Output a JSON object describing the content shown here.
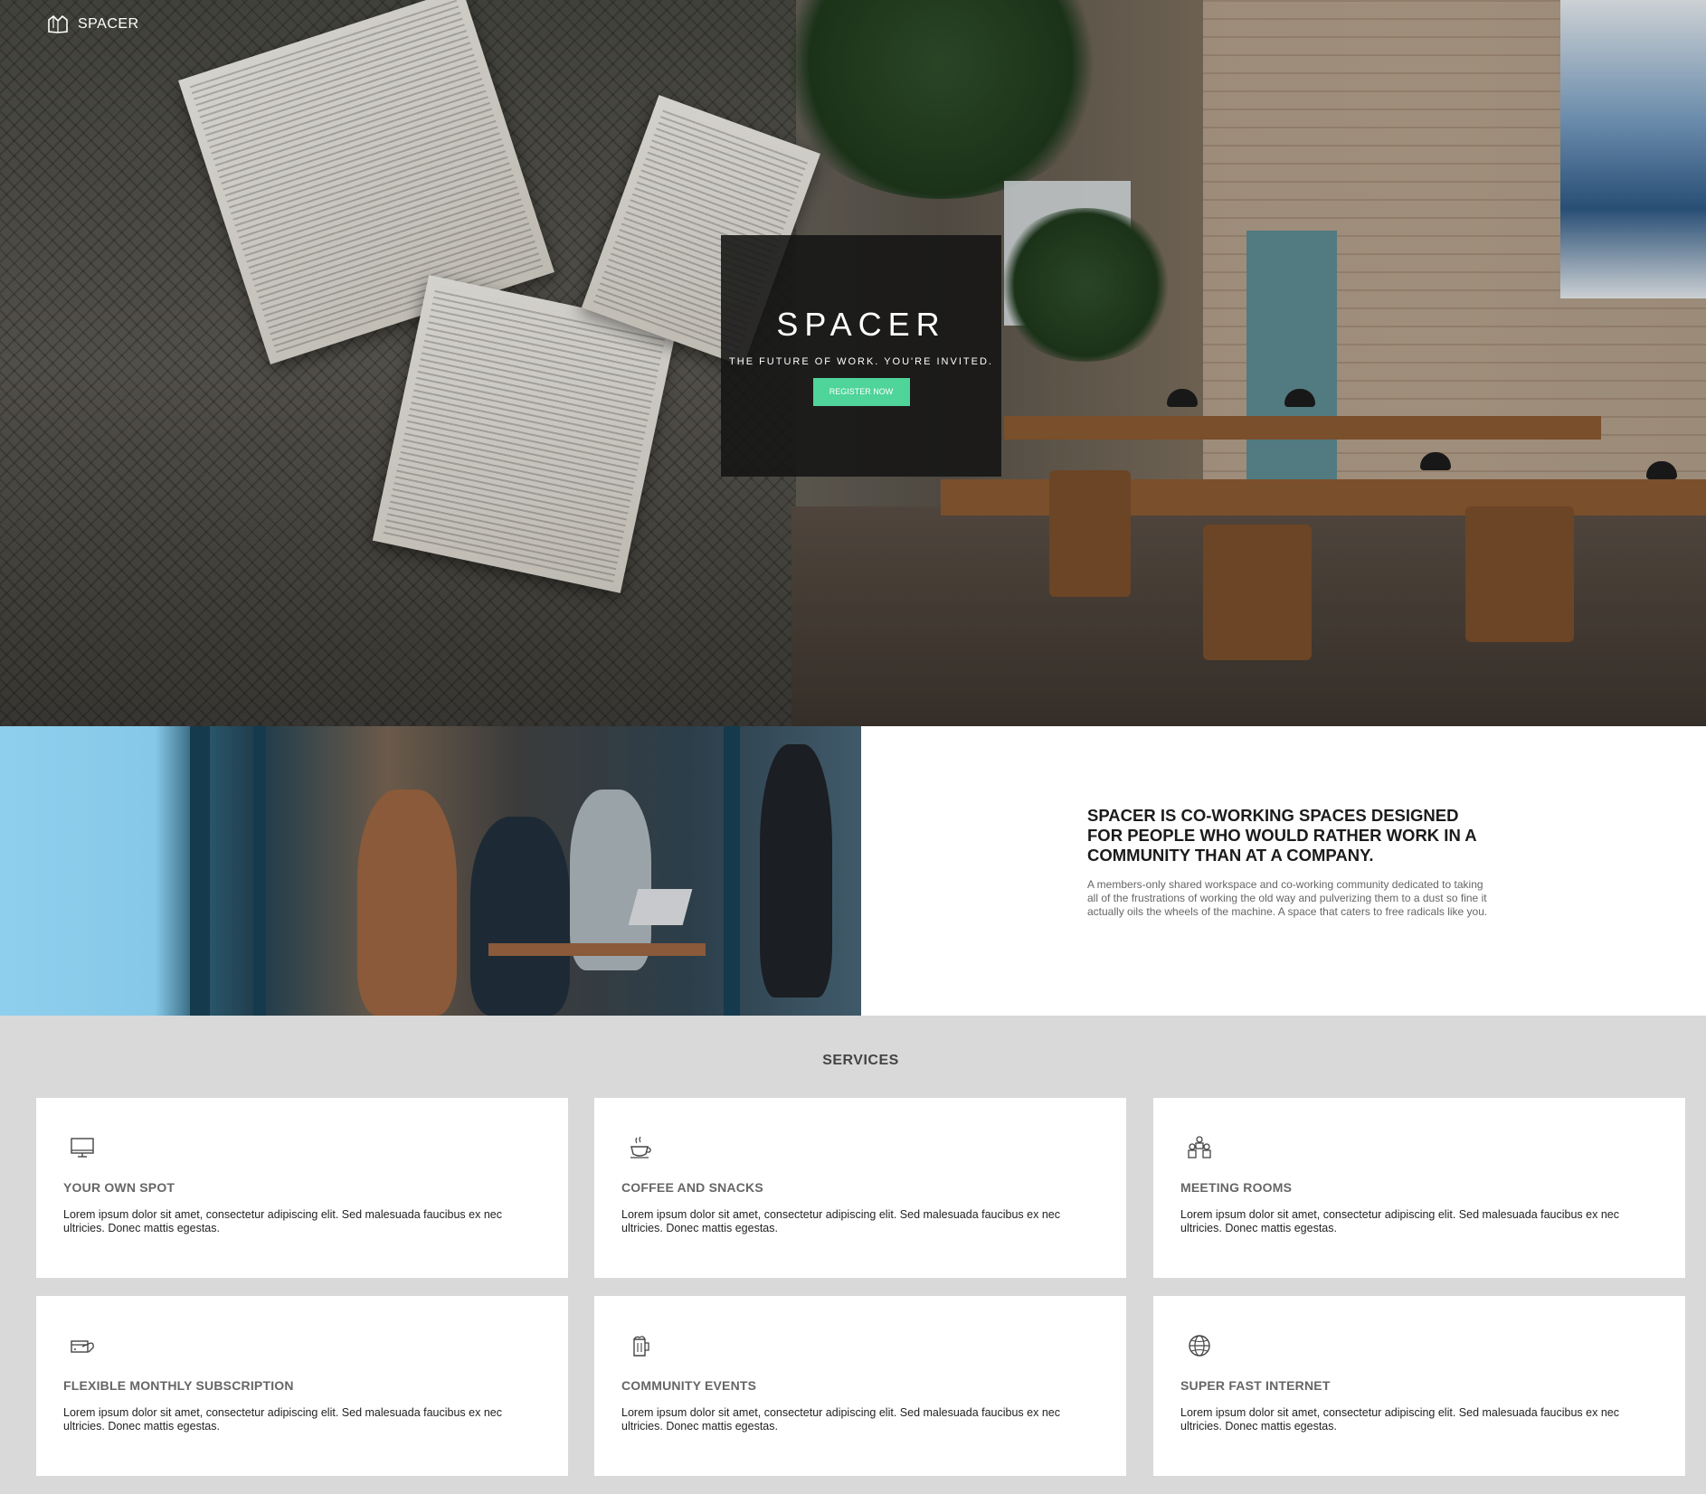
{
  "brand": {
    "name": "SPACER"
  },
  "hero": {
    "title": "SPACER",
    "subtitle": "THE FUTURE OF WORK. YOU'RE INVITED.",
    "cta_label": "REGISTER NOW"
  },
  "about": {
    "heading": "SPACER IS CO-WORKING SPACES DESIGNED FOR PEOPLE WHO WOULD RATHER WORK IN A COMMUNITY THAN AT A COMPANY.",
    "description": "A members-only shared workspace and co-working community dedicated to taking all of the frustrations of working the old way and pulverizing them to a dust so fine it actually oils the wheels of the machine. A space that caters to free radicals like you."
  },
  "services": {
    "title": "SERVICES",
    "items": [
      {
        "icon": "monitor-icon",
        "title": "YOUR OWN SPOT",
        "description": "Lorem ipsum dolor sit amet, consectetur adipiscing elit. Sed malesuada faucibus ex nec ultricies. Donec mattis egestas."
      },
      {
        "icon": "coffee-icon",
        "title": "COFFEE AND SNACKS",
        "description": "Lorem ipsum dolor sit amet, consectetur adipiscing elit. Sed malesuada faucibus ex nec ultricies. Donec mattis egestas."
      },
      {
        "icon": "people-icon",
        "title": "MEETING ROOMS",
        "description": "Lorem ipsum dolor sit amet, consectetur adipiscing elit. Sed malesuada faucibus ex nec ultricies. Donec mattis egestas."
      },
      {
        "icon": "card-payment-icon",
        "title": "FLEXIBLE MONTHLY SUBSCRIPTION",
        "description": "Lorem ipsum dolor sit amet, consectetur adipiscing elit. Sed malesuada faucibus ex nec ultricies. Donec mattis egestas."
      },
      {
        "icon": "beer-mug-icon",
        "title": "COMMUNITY EVENTS",
        "description": "Lorem ipsum dolor sit amet, consectetur adipiscing elit. Sed malesuada faucibus ex nec ultricies. Donec mattis egestas."
      },
      {
        "icon": "globe-icon",
        "title": "SUPER FAST INTERNET",
        "description": "Lorem ipsum dolor sit amet, consectetur adipiscing elit. Sed malesuada faucibus ex nec ultricies. Donec mattis egestas."
      }
    ]
  },
  "colors": {
    "accent": "#4fd49a",
    "services_bg": "#d9d9d9",
    "hero_box": "#141414"
  }
}
